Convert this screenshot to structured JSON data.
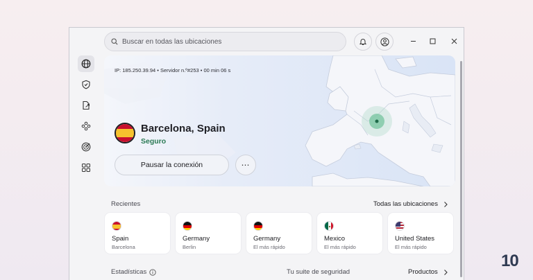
{
  "search": {
    "placeholder": "Buscar en todas las ubicaciones"
  },
  "connection": {
    "ip_line": "IP: 185.250.39.94 • Servidor n.º#253 • 00 min 06 s",
    "location": "Barcelona, Spain",
    "status": "Seguro",
    "pause_label": "Pausar la conexión",
    "more_label": "⋯"
  },
  "recents": {
    "label": "Recientes",
    "all_link": "Todas las ubicaciones",
    "items": [
      {
        "country": "Spain",
        "sub": "Barcelona",
        "flag": "spain-flag"
      },
      {
        "country": "Germany",
        "sub": "Berlin",
        "flag": "germany-flag"
      },
      {
        "country": "Germany",
        "sub": "El más rápido",
        "flag": "germany-flag"
      },
      {
        "country": "Mexico",
        "sub": "El más rápido",
        "flag": "mexico-flag"
      },
      {
        "country": "United States",
        "sub": "El más rápido",
        "flag": "usa-flag"
      }
    ]
  },
  "footer": {
    "stats": "Estadísticas",
    "suite": "Tu suite de seguridad",
    "products": "Productos"
  },
  "brand": {
    "logo": "10"
  },
  "colors": {
    "secure": "#2b7a55",
    "map_marker": "#3aa779",
    "sea": "#dde6f6"
  }
}
